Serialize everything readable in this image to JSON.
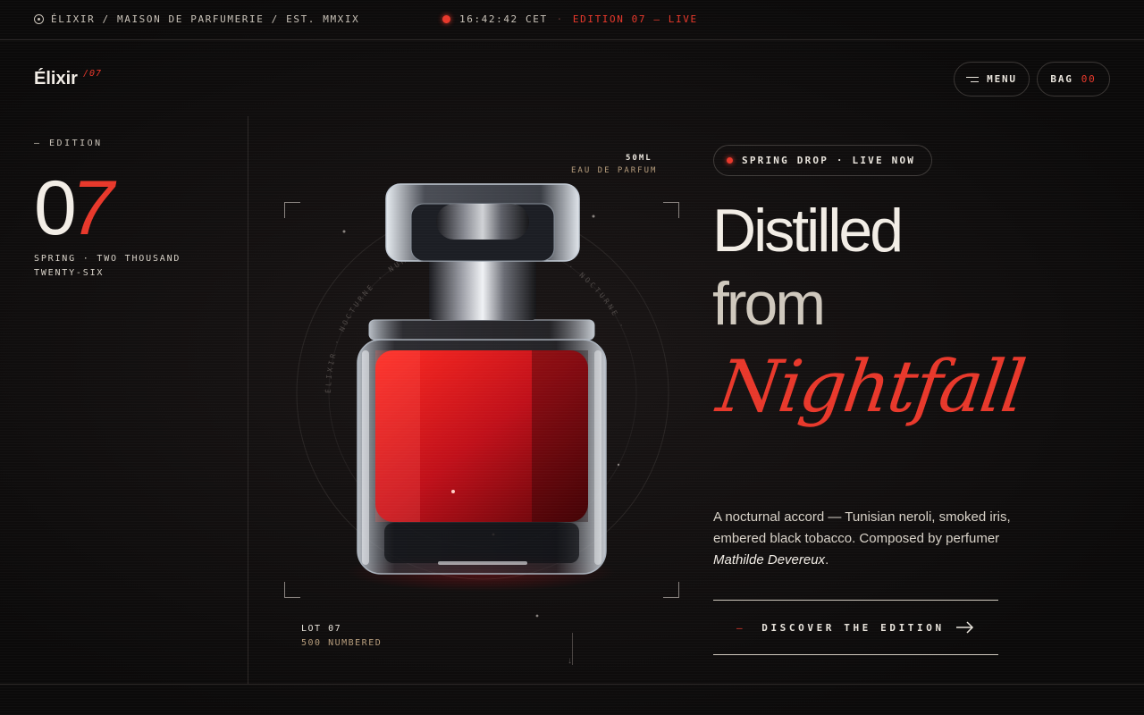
{
  "topbar": {
    "brandline": "ÉLIXIR / MAISON DE PARFUMERIE / EST. MMXIX",
    "time": "16:42:42 CET",
    "separator": "·",
    "edition_status": "EDITION 07 — LIVE"
  },
  "header": {
    "logo": "Élixir",
    "logo_sup": "/07",
    "menu_label": "MENU",
    "bag_label": "BAG",
    "bag_count": "00"
  },
  "edition": {
    "label": "— EDITION",
    "number_first": "0",
    "number_second": "7",
    "season": "SPRING · TWO THOUSAND TWENTY-SIX"
  },
  "product": {
    "size": "50ML",
    "type": "EAU DE PARFUM",
    "lot": "LOT 07",
    "numbered": "500 NUMBERED",
    "ring_text": "ÉLIXIR · NOCTURNE · NUMBERED · MMXXVI · ÉLIXIR · NOCTURNE ·"
  },
  "hero": {
    "badge": "SPRING DROP · LIVE NOW",
    "line1": "Distilled",
    "line2": "from",
    "line3": "Nightfall",
    "description_main": "A nocturnal accord — Tunisian neroli, smoked iris, embered black tobacco. Composed by perfumer ",
    "perfumer": "Mathilde Devereux",
    "description_end": ".",
    "cta": "DISCOVER THE EDITION",
    "cta_dash": "—"
  },
  "colors": {
    "accent": "#e8382b",
    "background": "#141212",
    "text": "#e9e4dc",
    "gold": "#b79d7c"
  },
  "icons": [
    "target-icon",
    "live-dot-icon",
    "hamburger-icon",
    "arrow-right-icon",
    "scroll-arrow-icon"
  ]
}
